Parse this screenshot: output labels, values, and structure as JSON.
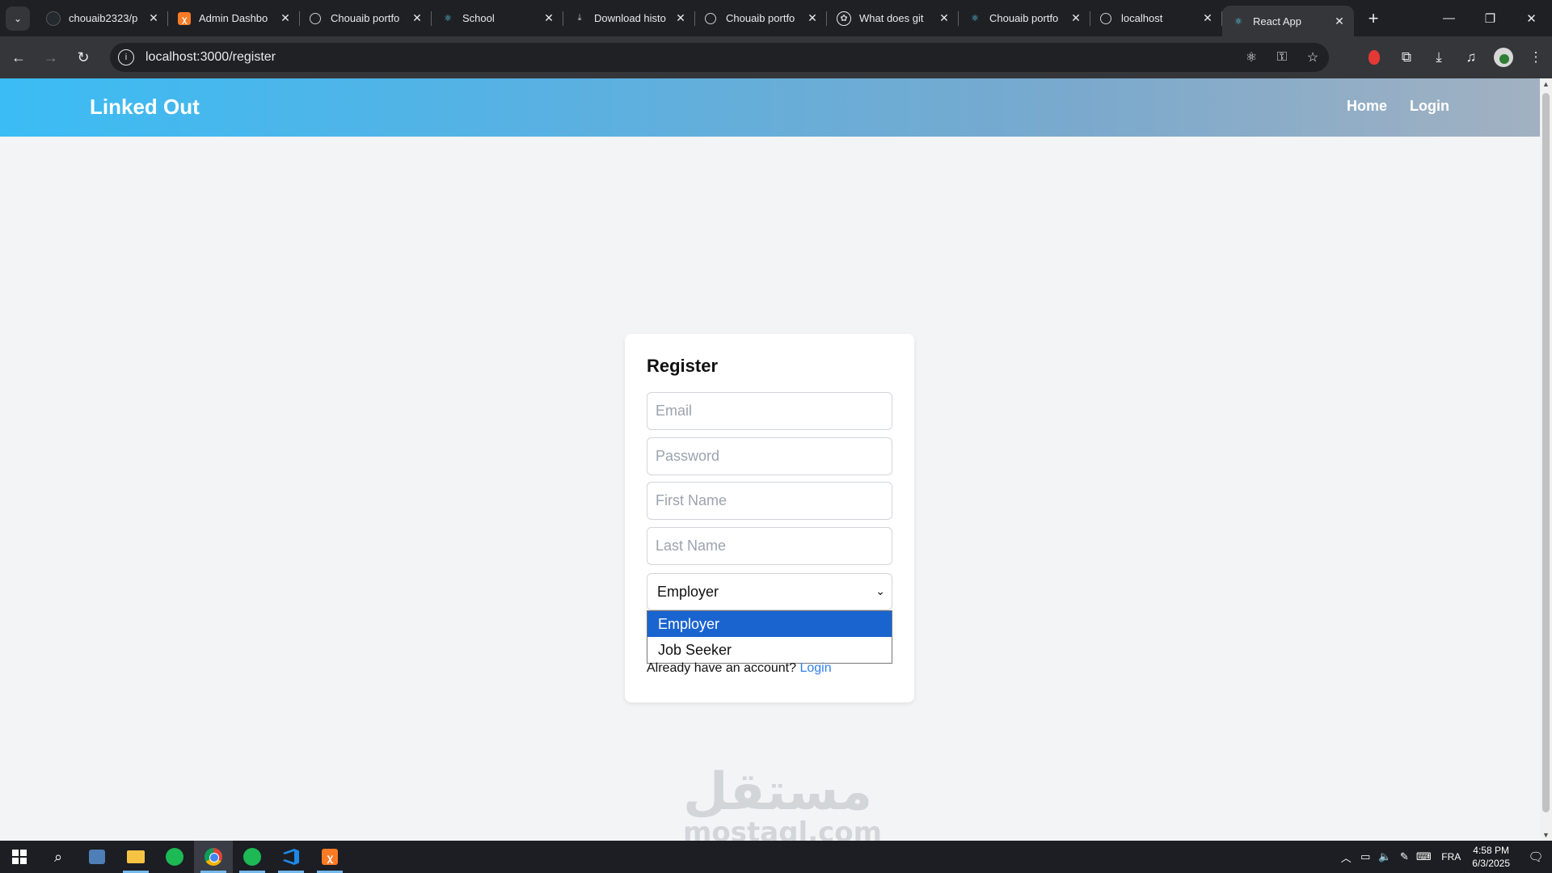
{
  "browser": {
    "tabs": [
      {
        "title": "chouaib2323/p",
        "favicon": "github-icon"
      },
      {
        "title": "Admin Dashbo",
        "favicon": "xampp-icon"
      },
      {
        "title": "Chouaib portfo",
        "favicon": "globe-icon"
      },
      {
        "title": "School",
        "favicon": "react-icon"
      },
      {
        "title": "Download histo",
        "favicon": "download-icon"
      },
      {
        "title": "Chouaib portfo",
        "favicon": "globe-icon"
      },
      {
        "title": "What does git",
        "favicon": "openai-icon"
      },
      {
        "title": "Chouaib portfo",
        "favicon": "react-icon"
      },
      {
        "title": "localhost",
        "favicon": "globe-icon"
      },
      {
        "title": "React App",
        "favicon": "react-icon",
        "active": true
      }
    ],
    "url": "localhost:3000/register"
  },
  "app": {
    "brand": "Linked Out",
    "nav": {
      "home": "Home",
      "login": "Login"
    },
    "colors": {
      "navbar_start": "#3bbcf4",
      "navbar_end": "#a2b1c1",
      "link": "#2f80ed",
      "selected_option": "#1a64cf"
    }
  },
  "register": {
    "title": "Register",
    "email_placeholder": "Email",
    "password_placeholder": "Password",
    "first_name_placeholder": "First Name",
    "last_name_placeholder": "Last Name",
    "role_selected": "Employer",
    "role_options": [
      "Employer",
      "Job Seeker"
    ],
    "login_prompt": "Already have an account?",
    "login_link": "Login"
  },
  "watermark": {
    "arabic": "مستقل",
    "latin": "mostaql.com"
  },
  "taskbar": {
    "language": "FRA",
    "time": "4:58 PM",
    "date": "6/3/2025"
  }
}
